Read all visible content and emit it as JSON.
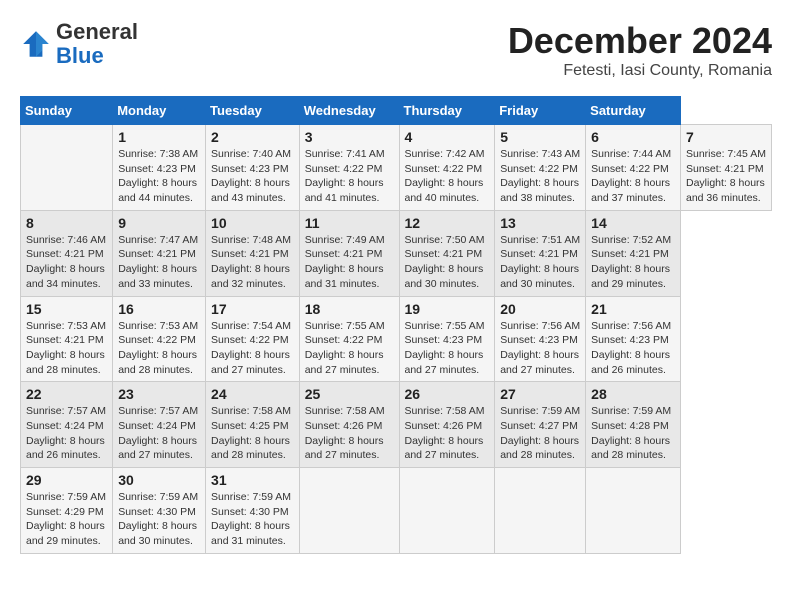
{
  "header": {
    "logo_line1": "General",
    "logo_line2": "Blue",
    "title": "December 2024",
    "subtitle": "Fetesti, Iasi County, Romania"
  },
  "calendar": {
    "days_of_week": [
      "Sunday",
      "Monday",
      "Tuesday",
      "Wednesday",
      "Thursday",
      "Friday",
      "Saturday"
    ],
    "weeks": [
      [
        {
          "day": "",
          "info": ""
        },
        {
          "day": "1",
          "info": "Sunrise: 7:38 AM\nSunset: 4:23 PM\nDaylight: 8 hours\nand 44 minutes."
        },
        {
          "day": "2",
          "info": "Sunrise: 7:40 AM\nSunset: 4:23 PM\nDaylight: 8 hours\nand 43 minutes."
        },
        {
          "day": "3",
          "info": "Sunrise: 7:41 AM\nSunset: 4:22 PM\nDaylight: 8 hours\nand 41 minutes."
        },
        {
          "day": "4",
          "info": "Sunrise: 7:42 AM\nSunset: 4:22 PM\nDaylight: 8 hours\nand 40 minutes."
        },
        {
          "day": "5",
          "info": "Sunrise: 7:43 AM\nSunset: 4:22 PM\nDaylight: 8 hours\nand 38 minutes."
        },
        {
          "day": "6",
          "info": "Sunrise: 7:44 AM\nSunset: 4:22 PM\nDaylight: 8 hours\nand 37 minutes."
        },
        {
          "day": "7",
          "info": "Sunrise: 7:45 AM\nSunset: 4:21 PM\nDaylight: 8 hours\nand 36 minutes."
        }
      ],
      [
        {
          "day": "8",
          "info": "Sunrise: 7:46 AM\nSunset: 4:21 PM\nDaylight: 8 hours\nand 34 minutes."
        },
        {
          "day": "9",
          "info": "Sunrise: 7:47 AM\nSunset: 4:21 PM\nDaylight: 8 hours\nand 33 minutes."
        },
        {
          "day": "10",
          "info": "Sunrise: 7:48 AM\nSunset: 4:21 PM\nDaylight: 8 hours\nand 32 minutes."
        },
        {
          "day": "11",
          "info": "Sunrise: 7:49 AM\nSunset: 4:21 PM\nDaylight: 8 hours\nand 31 minutes."
        },
        {
          "day": "12",
          "info": "Sunrise: 7:50 AM\nSunset: 4:21 PM\nDaylight: 8 hours\nand 30 minutes."
        },
        {
          "day": "13",
          "info": "Sunrise: 7:51 AM\nSunset: 4:21 PM\nDaylight: 8 hours\nand 30 minutes."
        },
        {
          "day": "14",
          "info": "Sunrise: 7:52 AM\nSunset: 4:21 PM\nDaylight: 8 hours\nand 29 minutes."
        }
      ],
      [
        {
          "day": "15",
          "info": "Sunrise: 7:53 AM\nSunset: 4:21 PM\nDaylight: 8 hours\nand 28 minutes."
        },
        {
          "day": "16",
          "info": "Sunrise: 7:53 AM\nSunset: 4:22 PM\nDaylight: 8 hours\nand 28 minutes."
        },
        {
          "day": "17",
          "info": "Sunrise: 7:54 AM\nSunset: 4:22 PM\nDaylight: 8 hours\nand 27 minutes."
        },
        {
          "day": "18",
          "info": "Sunrise: 7:55 AM\nSunset: 4:22 PM\nDaylight: 8 hours\nand 27 minutes."
        },
        {
          "day": "19",
          "info": "Sunrise: 7:55 AM\nSunset: 4:23 PM\nDaylight: 8 hours\nand 27 minutes."
        },
        {
          "day": "20",
          "info": "Sunrise: 7:56 AM\nSunset: 4:23 PM\nDaylight: 8 hours\nand 27 minutes."
        },
        {
          "day": "21",
          "info": "Sunrise: 7:56 AM\nSunset: 4:23 PM\nDaylight: 8 hours\nand 26 minutes."
        }
      ],
      [
        {
          "day": "22",
          "info": "Sunrise: 7:57 AM\nSunset: 4:24 PM\nDaylight: 8 hours\nand 26 minutes."
        },
        {
          "day": "23",
          "info": "Sunrise: 7:57 AM\nSunset: 4:24 PM\nDaylight: 8 hours\nand 27 minutes."
        },
        {
          "day": "24",
          "info": "Sunrise: 7:58 AM\nSunset: 4:25 PM\nDaylight: 8 hours\nand 28 minutes."
        },
        {
          "day": "25",
          "info": "Sunrise: 7:58 AM\nSunset: 4:26 PM\nDaylight: 8 hours\nand 27 minutes."
        },
        {
          "day": "26",
          "info": "Sunrise: 7:58 AM\nSunset: 4:26 PM\nDaylight: 8 hours\nand 27 minutes."
        },
        {
          "day": "27",
          "info": "Sunrise: 7:59 AM\nSunset: 4:27 PM\nDaylight: 8 hours\nand 28 minutes."
        },
        {
          "day": "28",
          "info": "Sunrise: 7:59 AM\nSunset: 4:28 PM\nDaylight: 8 hours\nand 28 minutes."
        }
      ],
      [
        {
          "day": "29",
          "info": "Sunrise: 7:59 AM\nSunset: 4:29 PM\nDaylight: 8 hours\nand 29 minutes."
        },
        {
          "day": "30",
          "info": "Sunrise: 7:59 AM\nSunset: 4:30 PM\nDaylight: 8 hours\nand 30 minutes."
        },
        {
          "day": "31",
          "info": "Sunrise: 7:59 AM\nSunset: 4:30 PM\nDaylight: 8 hours\nand 31 minutes."
        },
        {
          "day": "",
          "info": ""
        },
        {
          "day": "",
          "info": ""
        },
        {
          "day": "",
          "info": ""
        },
        {
          "day": "",
          "info": ""
        }
      ]
    ]
  }
}
